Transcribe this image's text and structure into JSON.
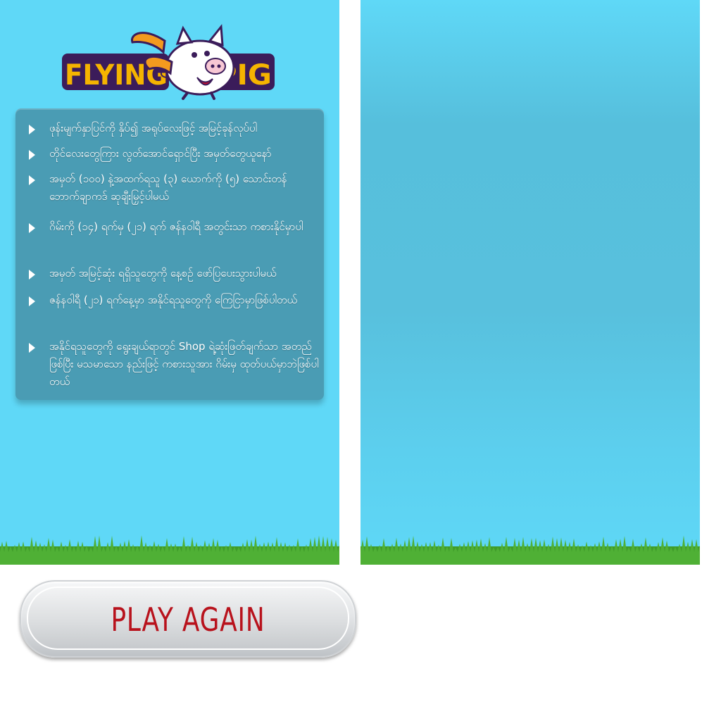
{
  "game": {
    "logo": {
      "text_left": "FLYING",
      "text_right": "PIG",
      "icon": "flying-pig-icon"
    },
    "instructions": [
      "ဖုန်းမျက်နှာပြင်ကို နှိပ်၍ အရုပ်လေးဖြင့် အမြင့်ခုန်လုပ်ပါ",
      "တိုင်လေးတွေကြား လွတ်အောင်ရှောင်ပြီး အမှတ်တွေယူနော်",
      "အမှတ် (၁၀၀) နဲ့အထက်ရသူ (၃) ယောက်ကို (၅) သောင်းတန် ဘောက်ချာကဒ် ဆုချီးမြှင့်ပါမယ်",
      "ဂိမ်းကို (၁၄) ရက်မှ (၂၁) ရက် ဇန်နဝါရီ အတွင်းသာ ကစားနိုင်မှာပါ",
      "အမှတ် အမြင့်ဆုံး ရရှိသူတွေကို နေ့စဉ် ဖော်ပြပေးသွားပါမယ်",
      "ဇန်နဝါရီ (၂၁) ရက်နေ့မှာ အနိုင်ရသူတွေကို ကြေငြာမှာဖြစ်ပါတယ်",
      "အနိုင်ရသူတွေကို ရွေးချယ်ရာတွင် Shop ရဲ့ဆုံးဖြတ်ချက်သာ အတည်ဖြစ်ပြီး မသမာသော နည်းဖြင့် ကစားသူအား ဂိမ်းမှ ထုတ်ပယ်မှာဘဲဖြစ်ပါတယ်"
    ],
    "play_again_label": "PLAY AGAIN"
  },
  "colors": {
    "sky": "#5fd8f7",
    "panel_box": "#4a9cb4",
    "grass": "#3f9c2a",
    "button_text": "#b8121c",
    "logo_text": "#f5b400",
    "logo_outline": "#3b1c5a"
  }
}
